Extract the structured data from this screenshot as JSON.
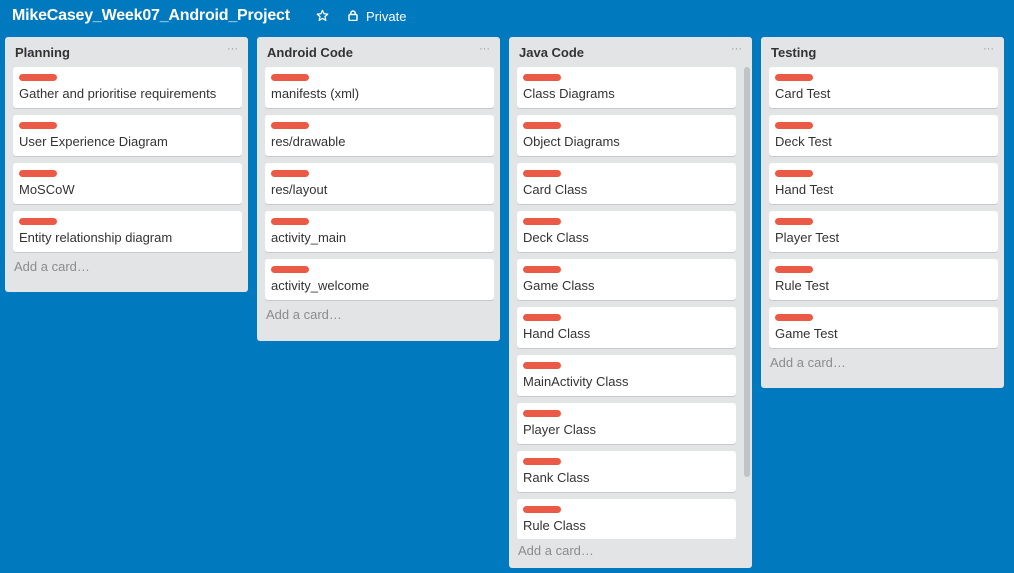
{
  "board": {
    "title": "MikeCasey_Week07_Android_Project",
    "privacy": "Private",
    "star_icon": "star-icon",
    "lock_icon": "lock-icon",
    "background_color": "#0079bf",
    "label_color": "#eb5a46"
  },
  "lists": [
    {
      "title": "Planning",
      "menu": "···",
      "cards": [
        "Gather and prioritise requirements",
        "User Experience Diagram",
        "MoSCoW",
        "Entity relationship diagram"
      ],
      "add_card": "Add a card…"
    },
    {
      "title": "Android Code",
      "menu": "···",
      "cards": [
        "manifests (xml)",
        "res/drawable",
        "res/layout",
        "activity_main",
        "activity_welcome"
      ],
      "add_card": "Add a card…"
    },
    {
      "title": "Java Code",
      "menu": "···",
      "cards": [
        "Class Diagrams",
        "Object Diagrams",
        "Card Class",
        "Deck Class",
        "Game Class",
        "Hand Class",
        "MainActivity Class",
        "Player Class",
        "Rank Class",
        "Rule Class"
      ],
      "add_card": "Add a card…"
    },
    {
      "title": "Testing",
      "menu": "···",
      "cards": [
        "Card Test",
        "Deck Test",
        "Hand Test",
        "Player Test",
        "Rule Test",
        "Game Test"
      ],
      "add_card": "Add a card…"
    }
  ]
}
